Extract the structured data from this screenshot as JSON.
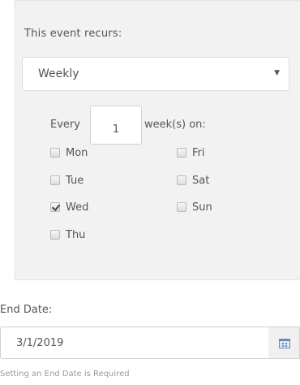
{
  "recurrence": {
    "label": "This event recurs:",
    "frequency": "Weekly",
    "every_label": "Every",
    "interval": "1",
    "unit_label": "week(s) on:",
    "days": [
      {
        "label": "Mon",
        "checked": false
      },
      {
        "label": "Tue",
        "checked": false
      },
      {
        "label": "Wed",
        "checked": true
      },
      {
        "label": "Thu",
        "checked": false
      },
      {
        "label": "Fri",
        "checked": false
      },
      {
        "label": "Sat",
        "checked": false
      },
      {
        "label": "Sun",
        "checked": false
      }
    ]
  },
  "end_date": {
    "label": "End Date:",
    "value": "3/1/2019",
    "hint": "Setting an End Date is Required"
  }
}
